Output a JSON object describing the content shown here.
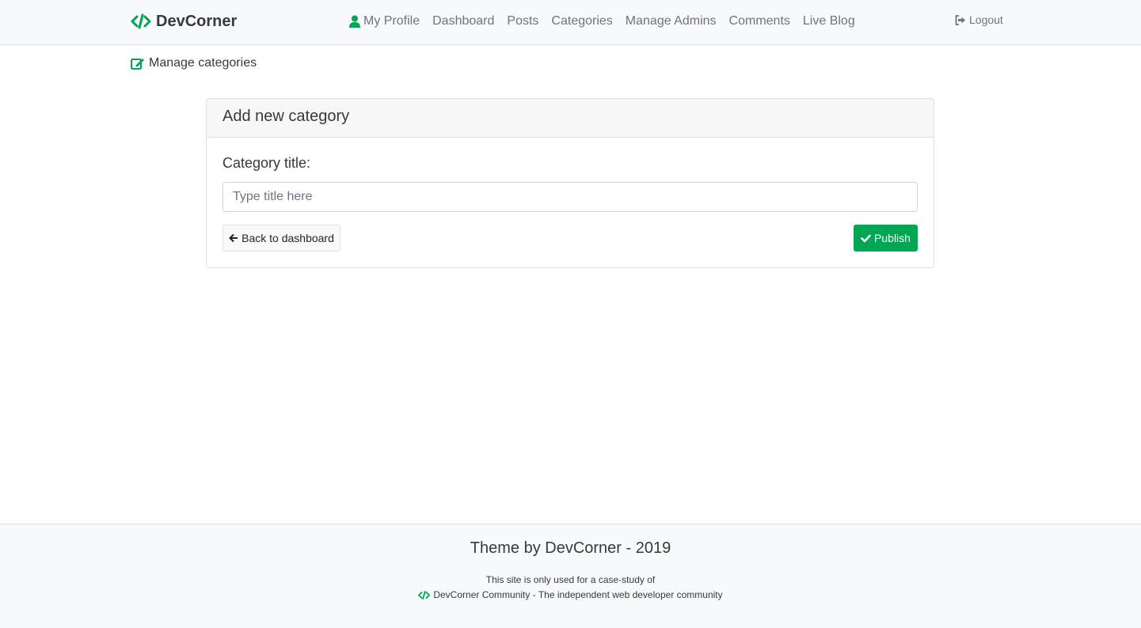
{
  "navbar": {
    "brand": "DevCorner",
    "brand_icon": "code-icon",
    "links": [
      {
        "label": "My Profile",
        "icon": "user-icon"
      },
      {
        "label": "Dashboard"
      },
      {
        "label": "Posts"
      },
      {
        "label": "Categories"
      },
      {
        "label": "Manage Admins"
      },
      {
        "label": "Comments"
      },
      {
        "label": "Live Blog"
      }
    ],
    "logout": "Logout",
    "logout_icon": "sign-out-icon"
  },
  "page": {
    "heading": "Manage categories",
    "heading_icon": "edit-icon"
  },
  "card": {
    "title": "Add new category",
    "field_label": "Category title:",
    "input_placeholder": "Type title here",
    "input_value": "",
    "back_button": "Back to dashboard",
    "publish_button": "Publish"
  },
  "footer": {
    "title": "Theme by DevCorner - 2019",
    "line1": "This site is only used for a case-study of",
    "line2": "DevCorner Community - The independent web developer community"
  },
  "colors": {
    "accent": "#00a651",
    "nav_bg": "#f8f9fa",
    "text": "#343a40",
    "muted": "#6c757d"
  }
}
